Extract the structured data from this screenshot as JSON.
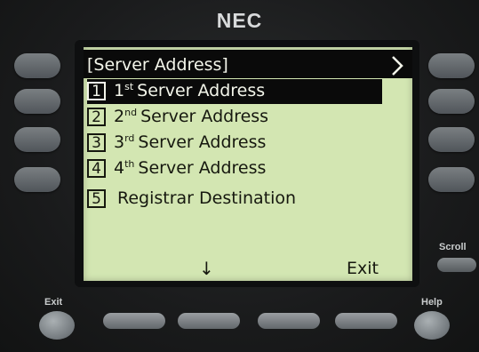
{
  "brand": "NEC",
  "screen": {
    "title": "[Server Address]",
    "nav_icon": "chevron-right-icon",
    "items": [
      {
        "number": "1",
        "ordinal": "1",
        "suffix": "st",
        "label": "Server Address",
        "selected": true
      },
      {
        "number": "2",
        "ordinal": "2",
        "suffix": "nd",
        "label": "Server Address",
        "selected": false
      },
      {
        "number": "3",
        "ordinal": "3",
        "suffix": "rd",
        "label": "Server Address",
        "selected": false
      },
      {
        "number": "4",
        "ordinal": "4",
        "suffix": "th",
        "label": "Server Address",
        "selected": false
      },
      {
        "number": "5",
        "label": "Registrar Destination",
        "selected": false
      }
    ],
    "softkey_arrow": "↓",
    "softkey_exit": "Exit"
  },
  "keys": {
    "exit_label": "Exit",
    "help_label": "Help",
    "scroll_label": "Scroll"
  },
  "colors": {
    "screen_bg": "#d3e6b2",
    "highlight_bg": "#0a0a0a",
    "body": "#1a1b1c"
  }
}
